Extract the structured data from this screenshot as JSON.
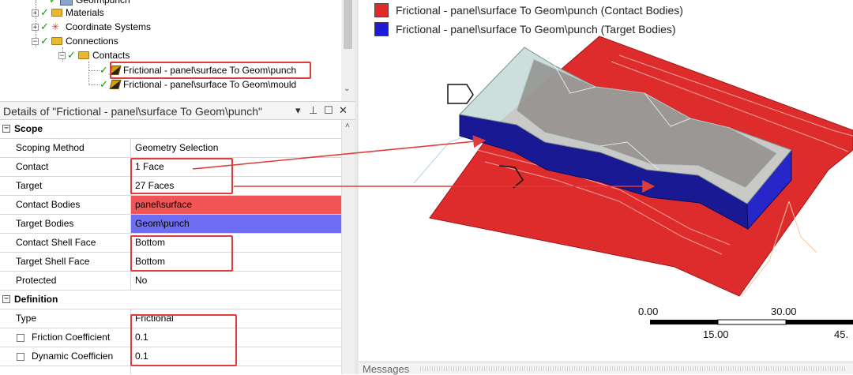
{
  "tree": {
    "items": [
      {
        "label": "Geom\\punch",
        "indent": 4
      },
      {
        "label": "Materials",
        "indent": 3
      },
      {
        "label": "Coordinate Systems",
        "indent": 3
      },
      {
        "label": "Connections",
        "indent": 3
      },
      {
        "label": "Contacts",
        "indent": 4
      },
      {
        "label": "Frictional - panel\\surface To Geom\\punch",
        "indent": 5,
        "selected": true
      },
      {
        "label": "Frictional - panel\\surface To Geom\\mould",
        "indent": 5
      }
    ]
  },
  "details": {
    "title": "Details of \"Frictional - panel\\surface To Geom\\punch\"",
    "pin_icon": "pin-icon",
    "maximize_icon": "maximize-icon",
    "close_icon": "close-icon",
    "sections": {
      "scope": "Scope",
      "definition": "Definition"
    },
    "rows": {
      "scoping_method": {
        "label": "Scoping Method",
        "value": "Geometry Selection"
      },
      "contact": {
        "label": "Contact",
        "value": "1 Face"
      },
      "target": {
        "label": "Target",
        "value": "27 Faces"
      },
      "contact_bodies": {
        "label": "Contact Bodies",
        "value": "panel\\surface"
      },
      "target_bodies": {
        "label": "Target Bodies",
        "value": "Geom\\punch"
      },
      "contact_shell_face": {
        "label": "Contact Shell Face",
        "value": "Bottom"
      },
      "target_shell_face": {
        "label": "Target Shell Face",
        "value": "Bottom"
      },
      "protected": {
        "label": "Protected",
        "value": "No"
      },
      "type": {
        "label": "Type",
        "value": "Frictional"
      },
      "friction_coefficient": {
        "label": "Friction Coefficient",
        "value": "0.1"
      },
      "dynamic_coefficient": {
        "label": "Dynamic Coefficien",
        "value": "0.1"
      }
    }
  },
  "viewport": {
    "legend": [
      {
        "label": "Frictional - panel\\surface To Geom\\punch (Contact Bodies)",
        "color": "#e02a2a"
      },
      {
        "label": "Frictional - panel\\surface To Geom\\punch (Target Bodies)",
        "color": "#1c1cd6"
      }
    ],
    "scale": {
      "labels_top": [
        "0.00",
        "30.00"
      ],
      "labels_bottom": [
        "15.00",
        "45."
      ]
    }
  },
  "messages": {
    "title": "Messages"
  },
  "colors": {
    "contact": "#e02a2a",
    "target": "#1c1cd6",
    "highlight": "#e03c3c",
    "contact_cell": "#f15555",
    "target_cell": "#6e6ef2"
  }
}
